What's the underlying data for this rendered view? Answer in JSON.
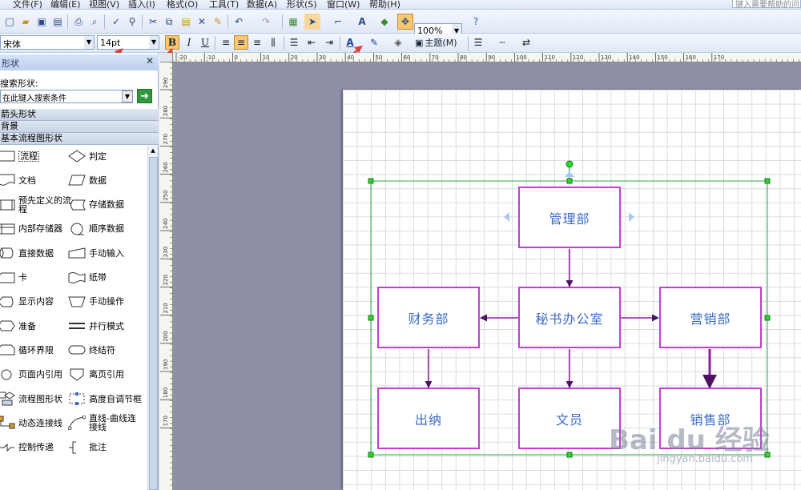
{
  "menu": [
    "文件(F)",
    "编辑(E)",
    "视图(V)",
    "插入(I)",
    "格式(O)",
    "工具(T)",
    "数据(A)",
    "形状(S)",
    "窗口(W)",
    "帮助(H)"
  ],
  "help_search_placeholder": "键入需要帮助的问",
  "toolbar": {
    "zoom": "100%"
  },
  "format_bar": {
    "font": "宋体",
    "size": "14pt",
    "bold": "B",
    "italic": "I",
    "underline": "U",
    "theme": "主题(M)"
  },
  "pane": {
    "title": "形状",
    "search_label": "搜索形状:",
    "search_placeholder": "在此键入搜索条件",
    "stencils": [
      "箭头形状",
      "背景",
      "基本流程图形状"
    ],
    "shapes": [
      {
        "label": "流程",
        "icon": "process-shape-icon"
      },
      {
        "label": "判定",
        "icon": "decision-shape-icon"
      },
      {
        "label": "文档",
        "icon": "document-shape-icon"
      },
      {
        "label": "数据",
        "icon": "data-shape-icon"
      },
      {
        "label": "预先定义的流程",
        "icon": "predefined-process-icon"
      },
      {
        "label": "存储数据",
        "icon": "stored-data-icon"
      },
      {
        "label": "内部存储器",
        "icon": "internal-storage-icon"
      },
      {
        "label": "顺序数据",
        "icon": "sequential-data-icon"
      },
      {
        "label": "直接数据",
        "icon": "direct-data-icon"
      },
      {
        "label": "手动输入",
        "icon": "manual-input-icon"
      },
      {
        "label": "卡",
        "icon": "card-icon"
      },
      {
        "label": "纸带",
        "icon": "paper-tape-icon"
      },
      {
        "label": "显示内容",
        "icon": "display-icon"
      },
      {
        "label": "手动操作",
        "icon": "manual-operation-icon"
      },
      {
        "label": "准备",
        "icon": "preparation-icon"
      },
      {
        "label": "并行模式",
        "icon": "parallel-mode-icon"
      },
      {
        "label": "循环界限",
        "icon": "loop-limit-icon"
      },
      {
        "label": "终结符",
        "icon": "terminator-icon"
      },
      {
        "label": "页面内引用",
        "icon": "on-page-reference-icon"
      },
      {
        "label": "离页引用",
        "icon": "off-page-reference-icon"
      },
      {
        "label": "流程图形状",
        "icon": "flowchart-shapes-icon"
      },
      {
        "label": "高度自调节框",
        "icon": "auto-height-box-icon"
      },
      {
        "label": "动态连接线",
        "icon": "dynamic-connector-icon"
      },
      {
        "label": "直线-曲线连接线",
        "icon": "line-curve-connector-icon"
      },
      {
        "label": "控制传递",
        "icon": "control-transfer-icon"
      },
      {
        "label": "批注",
        "icon": "annotation-icon"
      }
    ]
  },
  "ruler_h": [
    "-20",
    "-10",
    "0",
    "10",
    "20",
    "30",
    "40",
    "50",
    "60",
    "70",
    "80",
    "90",
    "100",
    "110",
    "120",
    "130",
    "140",
    "150",
    "160",
    "170"
  ],
  "ruler_v": [
    "290",
    "280",
    "270",
    "260",
    "250",
    "240",
    "230",
    "220",
    "210",
    "200",
    "190",
    "180",
    "170"
  ],
  "diagram": {
    "boxes": {
      "mgmt": "管理部",
      "secretary": "秘书办公室",
      "finance": "财务部",
      "sales": "营销部",
      "cashier": "出纳",
      "clerk": "文员",
      "salesdept": "销售部"
    }
  },
  "watermark": {
    "brand": "Bai du 经验",
    "url": "jingyan.baidu.com"
  },
  "colors": {
    "box_border": "#c23fcf",
    "box_text": "#3a6bc7",
    "selection": "#2fa84a",
    "connector": "#8e1f9b"
  }
}
